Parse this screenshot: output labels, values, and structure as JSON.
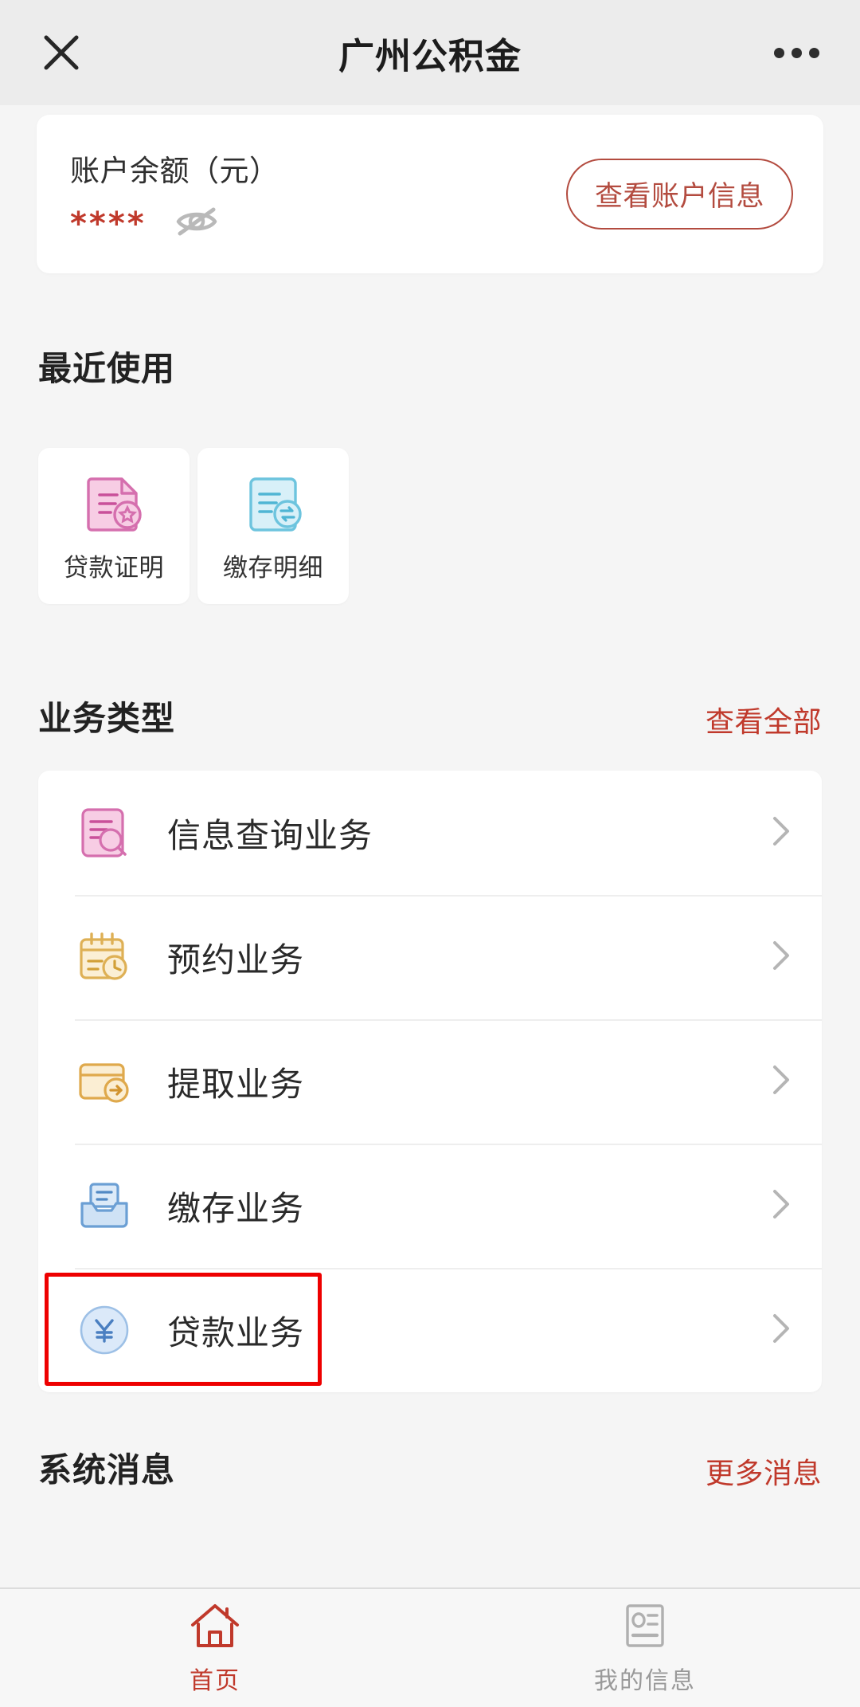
{
  "header": {
    "title": "广州公积金",
    "close_icon": "close-icon",
    "more_icon": "more-options-icon"
  },
  "balance": {
    "label": "账户余额（元）",
    "masked_value": "****",
    "eye_icon": "eye-off-icon",
    "view_account_label": "查看账户信息",
    "accent_color": "#b34b3f",
    "masked_color": "#c0392b"
  },
  "recent": {
    "title": "最近使用",
    "items": [
      {
        "label": "贷款证明",
        "icon": "document-star-icon",
        "color": "#e48fc3"
      },
      {
        "label": "缴存明细",
        "icon": "document-transfer-icon",
        "color": "#7cc9e0"
      }
    ]
  },
  "business": {
    "title": "业务类型",
    "view_all_label": "查看全部",
    "link_color": "#c0392b",
    "items": [
      {
        "label": "信息查询业务",
        "icon": "document-search-icon",
        "color": "#e48fc3",
        "highlighted": false
      },
      {
        "label": "预约业务",
        "icon": "calendar-clock-icon",
        "color": "#e0b04a",
        "highlighted": false
      },
      {
        "label": "提取业务",
        "icon": "wallet-arrow-icon",
        "color": "#e0a64a",
        "highlighted": false
      },
      {
        "label": "缴存业务",
        "icon": "inbox-document-icon",
        "color": "#6fa8dc",
        "highlighted": false
      },
      {
        "label": "贷款业务",
        "icon": "yuan-circle-icon",
        "color": "#5b8fd4",
        "highlighted": true
      }
    ],
    "chevron_icon": "chevron-right-icon",
    "highlight_color": "#ee0000"
  },
  "messages": {
    "title": "系统消息",
    "more_label": "更多消息",
    "link_color": "#c0392b"
  },
  "tabbar": {
    "tabs": [
      {
        "label": "首页",
        "icon": "home-icon",
        "active": true,
        "color": "#c0392b"
      },
      {
        "label": "我的信息",
        "icon": "id-card-icon",
        "active": false,
        "color": "#999999"
      }
    ]
  }
}
